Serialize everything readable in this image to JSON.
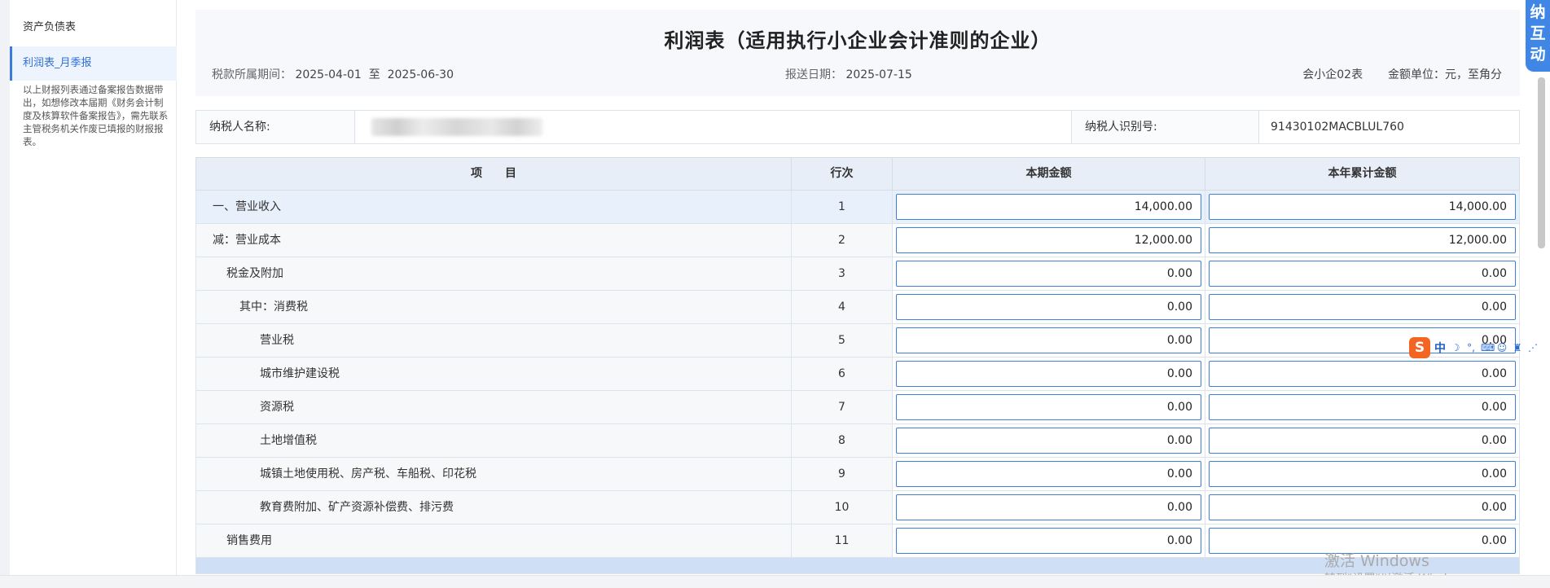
{
  "sidebar": {
    "items": [
      {
        "label": "资产负债表"
      },
      {
        "label": "利润表_月季报"
      }
    ],
    "note": "以上财报列表通过备案报告数据带出，如想修改本届期《财务会计制度及核算软件备案报告》，需先联系主管税务机关作废已填报的财报报表。"
  },
  "header": {
    "title": "利润表（适用执行小企业会计准则的企业）",
    "period_label": "税款所属期间：",
    "period_value": "2025-04-01  至  2025-06-30",
    "report_date_label": "报送日期：",
    "report_date_value": "2025-07-15",
    "form_code": "会小企02表",
    "unit_text": "金额单位：元，至角分"
  },
  "taxpayer": {
    "name_label": "纳税人名称:",
    "id_label": "纳税人识别号:",
    "id_value": "91430102MACBLUL760"
  },
  "table": {
    "columns": [
      "项　　目",
      "行次",
      "本期金额",
      "本年累计金额"
    ],
    "rows": [
      {
        "item": "一、营业收入",
        "no": "1",
        "current": "14,000.00",
        "ytd": "14,000.00"
      },
      {
        "item": "减：营业成本",
        "no": "2",
        "current": "12,000.00",
        "ytd": "12,000.00"
      },
      {
        "item": "税金及附加",
        "no": "3",
        "current": "0.00",
        "ytd": "0.00"
      },
      {
        "item": "其中：消费税",
        "no": "4",
        "current": "0.00",
        "ytd": "0.00"
      },
      {
        "item": "营业税",
        "no": "5",
        "current": "0.00",
        "ytd": "0.00"
      },
      {
        "item": "城市维护建设税",
        "no": "6",
        "current": "0.00",
        "ytd": "0.00"
      },
      {
        "item": "资源税",
        "no": "7",
        "current": "0.00",
        "ytd": "0.00"
      },
      {
        "item": "土地增值税",
        "no": "8",
        "current": "0.00",
        "ytd": "0.00"
      },
      {
        "item": "城镇土地使用税、房产税、车船税、印花税",
        "no": "9",
        "current": "0.00",
        "ytd": "0.00"
      },
      {
        "item": "教育费附加、矿产资源补偿费、排污费",
        "no": "10",
        "current": "0.00",
        "ytd": "0.00"
      },
      {
        "item": "销售费用",
        "no": "11",
        "current": "0.00",
        "ytd": "0.00"
      }
    ]
  },
  "float_button": {
    "label": "纳互动"
  },
  "ime": {
    "logo": "S",
    "mode": "中",
    "icons": [
      "moon-icon",
      "punctuation-icon",
      "keyboard-icon",
      "user-icon",
      "skin-icon",
      "more-icon"
    ]
  },
  "watermark": {
    "line1": "激活 Windows",
    "line2": "转到\"设置\"以激活 Windows。"
  },
  "colors": {
    "accent": "#3d7fd9",
    "header_bg": "#f6f8fc",
    "row_highlight": "#e8f0fb"
  }
}
